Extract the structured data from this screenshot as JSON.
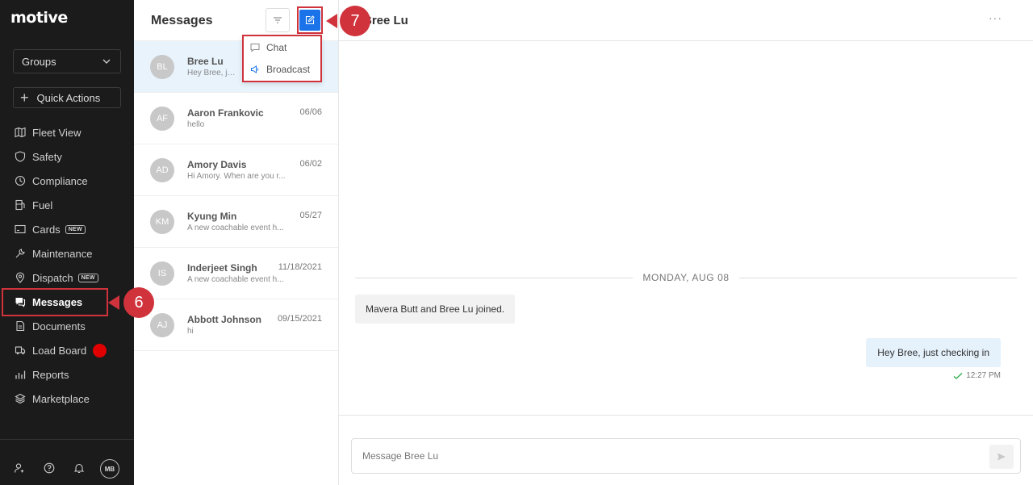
{
  "brand": {
    "logo_text": "motive"
  },
  "sidebar": {
    "groups_label": "Groups",
    "quick_actions_label": "Quick Actions",
    "items": [
      {
        "label": "Fleet View",
        "icon": "map-icon"
      },
      {
        "label": "Safety",
        "icon": "shield-icon"
      },
      {
        "label": "Compliance",
        "icon": "compliance-icon"
      },
      {
        "label": "Fuel",
        "icon": "fuel-icon"
      },
      {
        "label": "Cards",
        "icon": "card-icon",
        "badge": "NEW"
      },
      {
        "label": "Maintenance",
        "icon": "wrench-icon"
      },
      {
        "label": "Dispatch",
        "icon": "pin-icon",
        "badge": "NEW"
      },
      {
        "label": "Messages",
        "icon": "messages-icon",
        "active": true
      },
      {
        "label": "Documents",
        "icon": "document-icon"
      },
      {
        "label": "Load Board",
        "icon": "truck-icon",
        "indicator": "red-dot"
      },
      {
        "label": "Reports",
        "icon": "reports-icon"
      },
      {
        "label": "Marketplace",
        "icon": "layers-icon"
      }
    ],
    "footer": {
      "avatar_initials": "MB"
    }
  },
  "messages_panel": {
    "title": "Messages",
    "conversations": [
      {
        "initials": "BL",
        "name": "Bree Lu",
        "preview": "Hey Bree, just checking in",
        "date": ""
      },
      {
        "initials": "AF",
        "name": "Aaron Frankovic",
        "preview": "hello",
        "date": "06/06"
      },
      {
        "initials": "AD",
        "name": "Amory Davis",
        "preview": "Hi Amory. When are you r...",
        "date": "06/02"
      },
      {
        "initials": "KM",
        "name": "Kyung Min",
        "preview": "A new coachable event h...",
        "date": "05/27"
      },
      {
        "initials": "IS",
        "name": "Inderjeet Singh",
        "preview": "A new coachable event h...",
        "date": "11/18/2021"
      },
      {
        "initials": "AJ",
        "name": "Abbott Johnson",
        "preview": "hi",
        "date": "09/15/2021"
      }
    ],
    "new_menu": {
      "items": [
        "Chat",
        "Broadcast"
      ]
    }
  },
  "chat": {
    "title": "Bree Lu",
    "more_label": "···",
    "day_separator": "MONDAY, AUG 08",
    "system_message": "Mavera Butt and Bree Lu joined.",
    "outgoing": {
      "text": "Hey Bree, just checking in",
      "time": "12:27 PM"
    },
    "composer_placeholder": "Message Bree Lu"
  },
  "annotations": {
    "step_messages": "6",
    "step_compose": "7"
  },
  "colors": {
    "sidebar_bg": "#1b1b1b",
    "accent_blue": "#1a73e8",
    "callout_red": "#d0333c",
    "selected_row": "#e8f3fc"
  }
}
